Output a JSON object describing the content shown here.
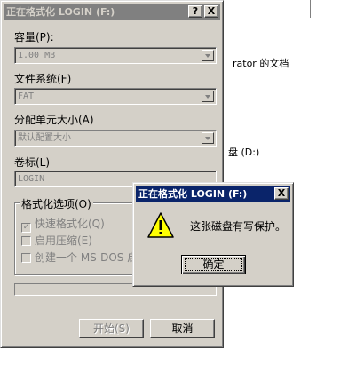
{
  "background": {
    "text1": "rator 的文档",
    "text2": "盘 (D:)"
  },
  "format_dialog": {
    "title": "正在格式化 LOGIN (F:)",
    "help_button": "?",
    "close_button": "X",
    "capacity_label": "容量(P):",
    "capacity_value": "1.00 MB",
    "filesystem_label": "文件系统(F)",
    "filesystem_value": "FAT",
    "allocation_label": "分配单元大小(A)",
    "allocation_value": "默认配置大小",
    "volume_label": "卷标(L)",
    "volume_value": "LOGIN",
    "options_group_label": "格式化选项(O)",
    "options": [
      {
        "label": "快速格式化(Q)",
        "checked": true
      },
      {
        "label": "启用压缩(E)",
        "checked": false
      },
      {
        "label": "创建一个 MS-DOS 启",
        "checked": false
      }
    ],
    "start_button": "开始(S)",
    "cancel_button": "取消"
  },
  "alert_dialog": {
    "title": "正在格式化 LOGIN (F:)",
    "close_button": "X",
    "message": "这张磁盘有写保护。",
    "icon": "warning-icon",
    "ok_button": "确定"
  },
  "colors": {
    "active_title": "#0a246a",
    "inactive_title": "#808080",
    "face": "#d4d0c8"
  }
}
